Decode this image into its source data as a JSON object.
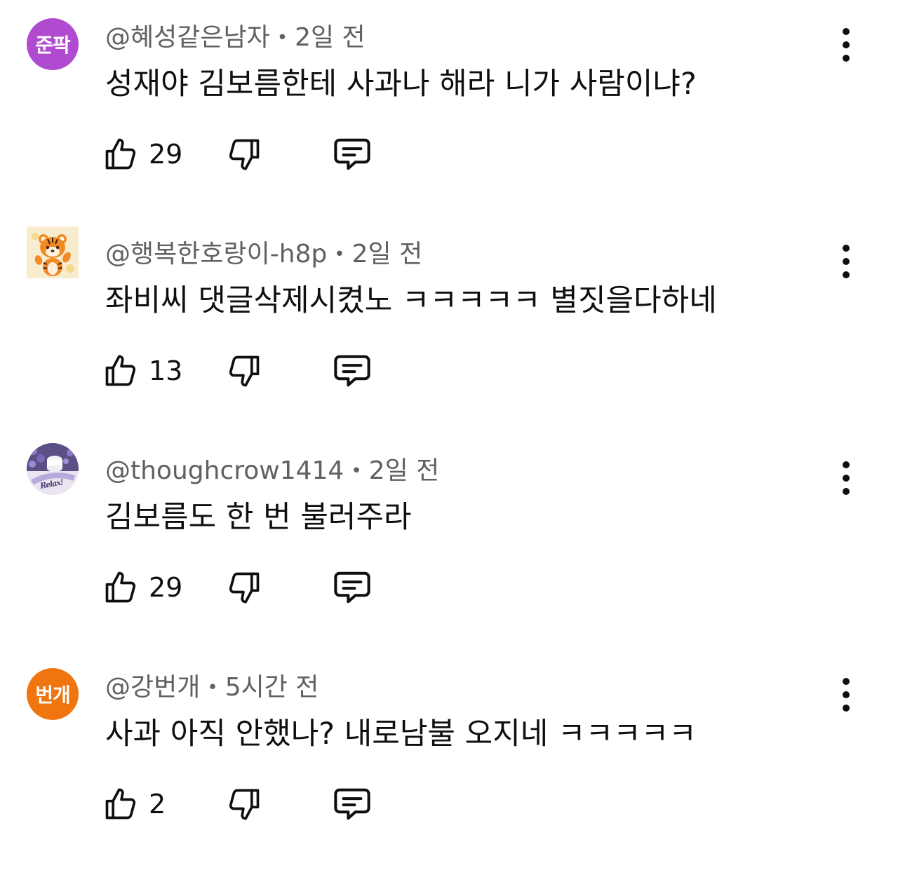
{
  "comments": [
    {
      "author": "@혜성같은남자",
      "time": "2일 전",
      "text": "성재야 김보름한테 사과나 해라 니가 사람이냐?",
      "likes": "29",
      "avatar_text": "준팍",
      "avatar_color": "#b04bd1"
    },
    {
      "author": "@행복한호랑이-h8p",
      "time": "2일 전",
      "text": "좌비씨 댓글삭제시켰노 ㅋㅋㅋㅋㅋ 별짓을다하네",
      "likes": "13",
      "avatar_icon": "tiger-avatar-icon"
    },
    {
      "author": "@thoughcrow1414",
      "time": "2일 전",
      "text": "김보름도 한 번 불러주라",
      "likes": "29",
      "avatar_text": "Relax!",
      "avatar_icon": "lavender-candle-avatar-icon"
    },
    {
      "author": "@강번개",
      "time": "5시간 전",
      "text": "사과 아직 안했나? 내로남불 오지네 ㅋㅋㅋㅋㅋ",
      "likes": "2",
      "avatar_text": "번개",
      "avatar_color": "#f0750f"
    }
  ],
  "separator": "•",
  "icons": {
    "like": "thumbs-up-icon",
    "dislike": "thumbs-down-icon",
    "reply": "reply-comment-icon",
    "more": "more-vert-icon"
  }
}
